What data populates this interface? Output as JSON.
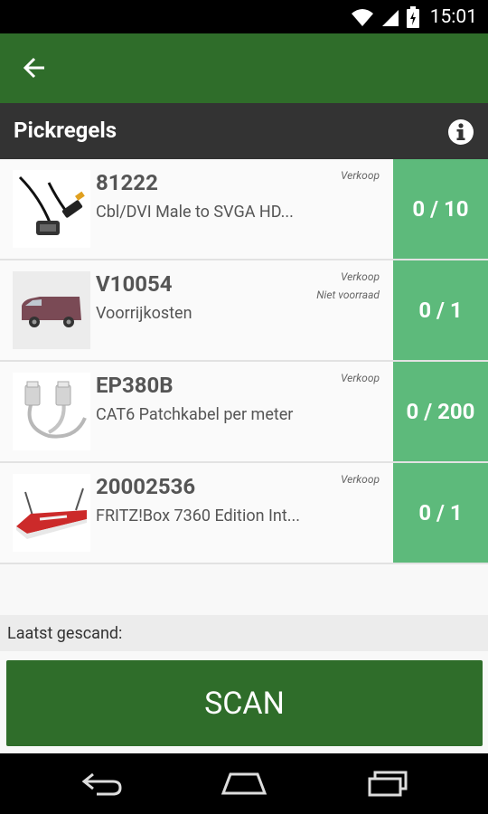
{
  "status_bar": {
    "time": "15:01",
    "icons": [
      "wifi-icon",
      "signal-icon",
      "battery-icon"
    ]
  },
  "app_bar": {
    "back_icon": "arrow-back-icon",
    "color": "#2f6d2a"
  },
  "section": {
    "title": "Pickregels",
    "info_icon": "info-icon"
  },
  "rows": [
    {
      "code": "81222",
      "description": "Cbl/DVI Male to SVGA HD...",
      "tags": [
        "Verkoop"
      ],
      "quantity": "0 / 10",
      "image": "dvi-vga-cable-image"
    },
    {
      "code": "V10054",
      "description": "Voorrijkosten",
      "tags": [
        "Verkoop",
        "Niet voorraad"
      ],
      "quantity": "0 / 1",
      "image": "delivery-van-image"
    },
    {
      "code": "EP380B",
      "description": "CAT6 Patchkabel per meter",
      "tags": [
        "Verkoop"
      ],
      "quantity": "0 / 200",
      "image": "patch-cable-image"
    },
    {
      "code": "20002536",
      "description": "FRITZ!Box 7360 Edition Int...",
      "tags": [
        "Verkoop"
      ],
      "quantity": "0 / 1",
      "image": "router-image"
    }
  ],
  "last_scanned": {
    "label": "Laatst gescand:"
  },
  "scan_button": {
    "label": "SCAN"
  },
  "nav_bar": {
    "icons": [
      "back-nav-icon",
      "home-nav-icon",
      "recents-nav-icon"
    ]
  },
  "colors": {
    "primary": "#2f6d2a",
    "quantity_bg": "#5dba7b",
    "header_bg": "#333333"
  }
}
